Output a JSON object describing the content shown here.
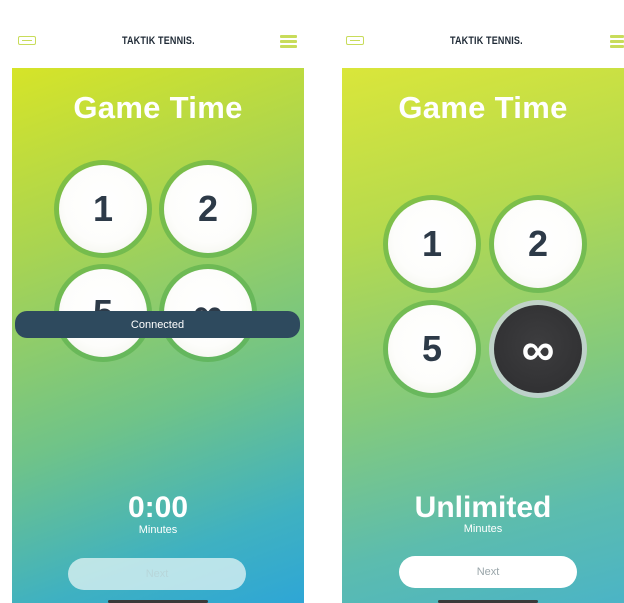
{
  "phones": {
    "left": {
      "brand": "TAKTIK TENNIS.",
      "title": "Game Time",
      "options": [
        "1",
        "2",
        "5",
        "∞"
      ],
      "toast": "Connected",
      "time_value": "0:00",
      "time_unit": "Minutes",
      "next_label": "Next"
    },
    "right": {
      "brand": "TAKTIK TENNIS.",
      "title": "Game Time",
      "options": [
        "1",
        "2",
        "5",
        "∞"
      ],
      "selected_option": "∞",
      "time_value": "Unlimited",
      "time_unit": "Minutes",
      "next_label": "Next"
    }
  },
  "colors": {
    "accent": "#c8dc5a",
    "toast_bg": "#2e4a5e",
    "selected_circle": "#2d2d2f",
    "number_text": "#2d3a48"
  },
  "icons": [
    "racket-logo-icon",
    "hamburger-menu-icon"
  ]
}
